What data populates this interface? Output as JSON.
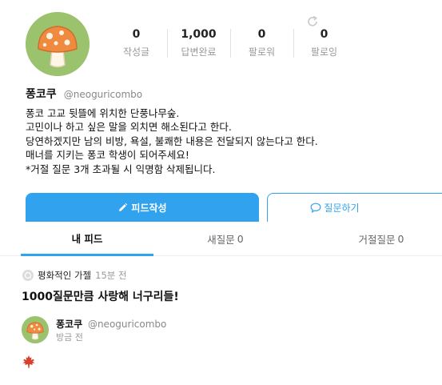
{
  "profile": {
    "name": "퐁코쿠",
    "handle": "@neoguricombo",
    "avatar_icon": "mushroom-avatar",
    "bio_lines": [
      "퐁코 고교 뒷뜰에 위치한 단풍나무숲.",
      "고민이나 하고 싶은 말을 외치면 해소된다고 한다.",
      "당연하겠지만 남의 비방, 욕설, 불쾌한 내용은 전달되지 않는다고 한다.",
      "매너를 지키는 퐁코 학생이 되어주세요!",
      "*거절 질문 3개 초과될 시 익명함 삭제됩니다."
    ]
  },
  "stats": [
    {
      "value": "0",
      "label": "작성글"
    },
    {
      "value": "1,000",
      "label": "답변완료"
    },
    {
      "value": "0",
      "label": "팔로워"
    },
    {
      "value": "0",
      "label": "팔로잉"
    }
  ],
  "actions": {
    "feed_label": "피드작성",
    "ask_label": "질문하기"
  },
  "tabs": {
    "mine": "내 피드",
    "new_label": "새질문",
    "new_count": "0",
    "rejected_label": "거절질문",
    "rejected_count": "0"
  },
  "post": {
    "asker": "평화적인 가젤",
    "time": "15분 전",
    "question": "1000질문만큼 사랑해 너구리들!",
    "answer": {
      "name": "퐁코쿠",
      "handle": "@neoguricombo",
      "time": "방금 전",
      "content_icon": "maple-leaf-icon"
    }
  },
  "colors": {
    "accent": "#30a2ee",
    "avatar_bg": "#9bc26d",
    "mushroom_cap": "#e8823b",
    "leaf": "#d9402b"
  }
}
